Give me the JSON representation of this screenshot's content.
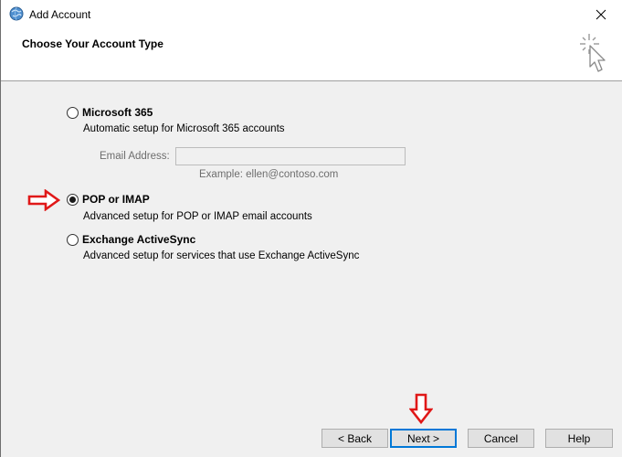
{
  "window": {
    "title": "Add Account"
  },
  "header": {
    "title": "Choose Your Account Type"
  },
  "options": [
    {
      "label": "Microsoft 365",
      "description": "Automatic setup for Microsoft 365 accounts",
      "selected": false
    },
    {
      "label": "POP or IMAP",
      "description": "Advanced setup for POP or IMAP email accounts",
      "selected": true
    },
    {
      "label": "Exchange ActiveSync",
      "description": "Advanced setup for services that use Exchange ActiveSync",
      "selected": false
    }
  ],
  "email": {
    "label": "Email Address:",
    "value": "",
    "example": "Example: ellen@contoso.com"
  },
  "buttons": {
    "back": "< Back",
    "next": "Next >",
    "cancel": "Cancel",
    "help": "Help"
  },
  "icons": {
    "title": "outlook-globe-icon",
    "close": "close-icon",
    "wizard": "wizard-cursor-icon",
    "annotation_arrows": "red-arrow-icon"
  },
  "colors": {
    "annotation": "#e01818",
    "primary_button_border": "#0078d7",
    "header_bg": "#ffffff",
    "body_bg": "#f0f0f0"
  }
}
